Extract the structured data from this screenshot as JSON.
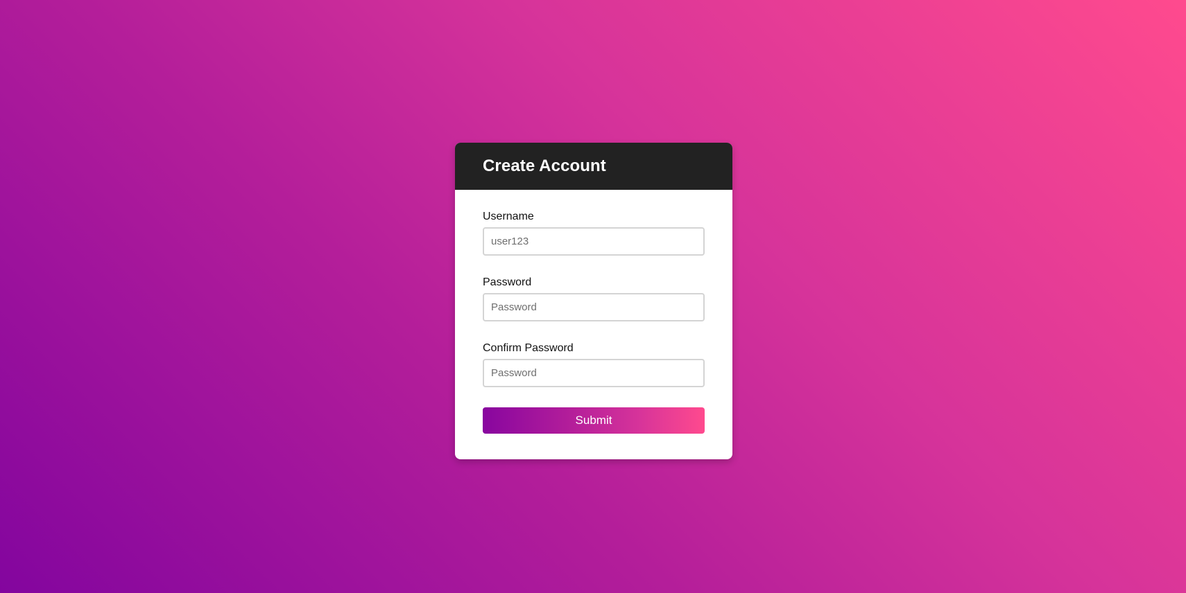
{
  "form": {
    "title": "Create Account",
    "fields": [
      {
        "label": "Username",
        "value": "",
        "placeholder": "user123",
        "type": "text"
      },
      {
        "label": "Password",
        "value": "",
        "placeholder": "Password",
        "type": "password"
      },
      {
        "label": "Confirm Password",
        "value": "",
        "placeholder": "Password",
        "type": "password"
      }
    ],
    "submit_label": "Submit"
  },
  "colors": {
    "background_start": "#83059e",
    "background_end": "#ff4a8e",
    "header_bg": "#222222",
    "card_bg": "#ffffff",
    "button_gradient_start": "#88069f",
    "button_gradient_end": "#ff4a8e"
  }
}
